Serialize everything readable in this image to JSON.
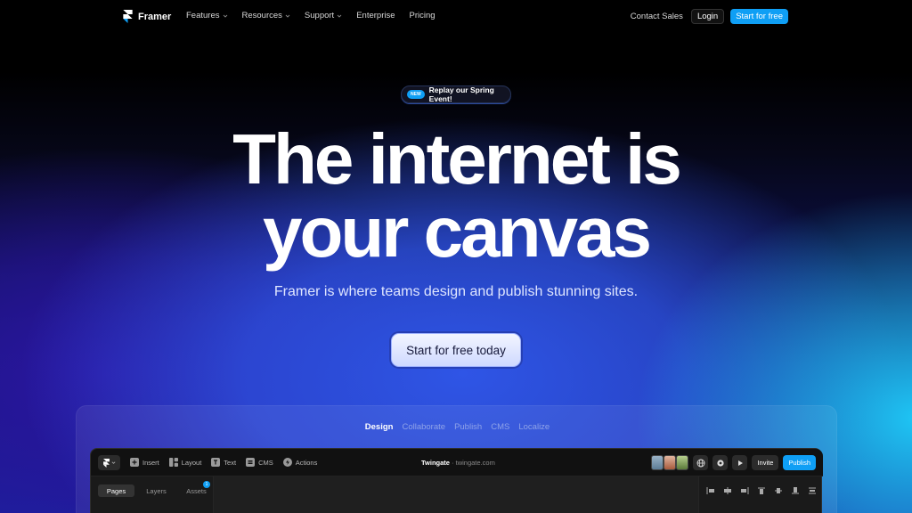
{
  "nav": {
    "brand": "Framer",
    "links": [
      {
        "label": "Features",
        "has_menu": true
      },
      {
        "label": "Resources",
        "has_menu": true
      },
      {
        "label": "Support",
        "has_menu": true
      },
      {
        "label": "Enterprise",
        "has_menu": false
      },
      {
        "label": "Pricing",
        "has_menu": false
      }
    ],
    "contact": "Contact Sales",
    "login": "Login",
    "start": "Start for free"
  },
  "hero": {
    "pill_badge": "NEW",
    "pill_text": "Replay our Spring Event!",
    "headline_line1": "The internet is",
    "headline_line2": "your canvas",
    "subtitle": "Framer is where teams design and publish stunning sites.",
    "cta": "Start for free today"
  },
  "demo": {
    "tabs": [
      "Design",
      "Collaborate",
      "Publish",
      "CMS",
      "Localize"
    ],
    "active_tab": "Design",
    "toolbar": {
      "tools": [
        "Insert",
        "Layout",
        "Text",
        "CMS",
        "Actions"
      ],
      "site_name": "Twingate",
      "site_url": "· twingate.com",
      "invite": "Invite",
      "publish": "Publish"
    },
    "panel": {
      "tabs": [
        "Pages",
        "Layers",
        "Assets"
      ],
      "active_tab": "Pages",
      "badge": "1"
    }
  },
  "colors": {
    "accent": "#0f9ff5",
    "background": "#000000",
    "glow_blue": "#2f55e6",
    "glow_cyan": "#1fc6f5"
  }
}
